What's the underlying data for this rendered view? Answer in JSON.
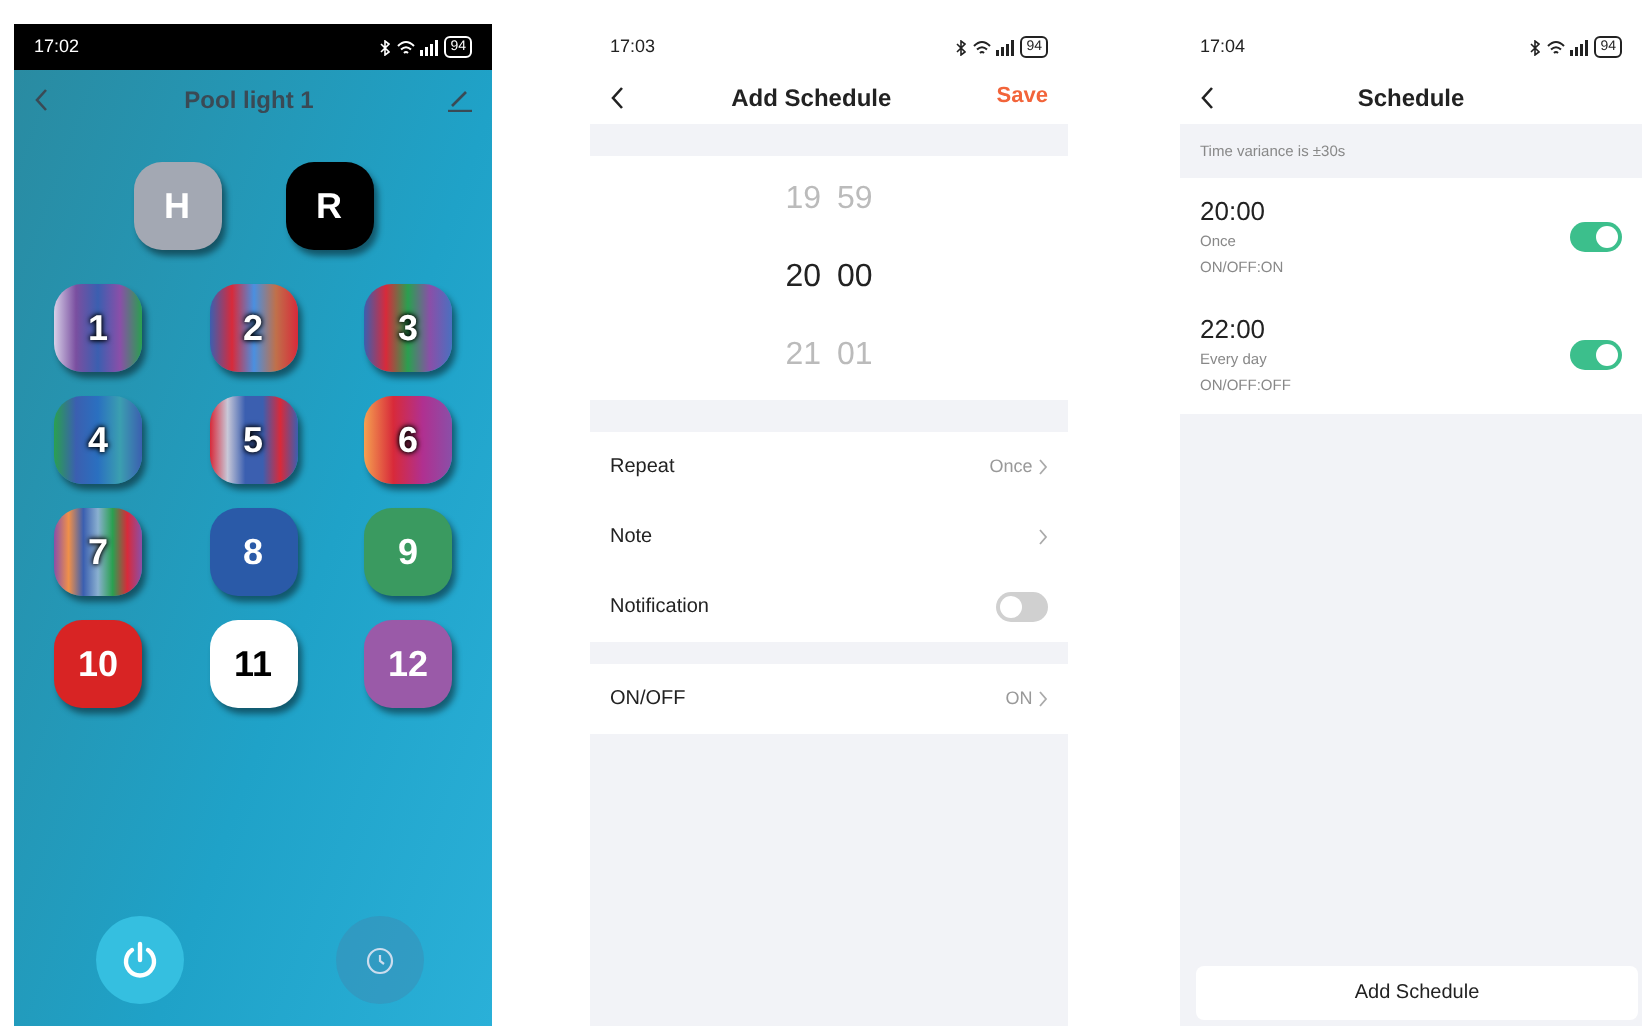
{
  "remote_screen": {
    "status_bar": {
      "time": "17:02",
      "battery": "94"
    },
    "title": "Pool light 1",
    "mode_buttons": [
      {
        "label": "H",
        "color": "#a3a8b3"
      },
      {
        "label": "R",
        "color": "#000000"
      }
    ],
    "color_buttons": [
      {
        "label": "1",
        "kind": "multicolor"
      },
      {
        "label": "2",
        "kind": "multicolor"
      },
      {
        "label": "3",
        "kind": "multicolor"
      },
      {
        "label": "4",
        "kind": "multicolor"
      },
      {
        "label": "5",
        "kind": "multicolor"
      },
      {
        "label": "6",
        "kind": "multicolor"
      },
      {
        "label": "7",
        "kind": "multicolor"
      },
      {
        "label": "8",
        "kind": "solid",
        "color": "#2a5aa8"
      },
      {
        "label": "9",
        "kind": "solid",
        "color": "#3a9a60"
      },
      {
        "label": "10",
        "kind": "solid",
        "color": "#d82424"
      },
      {
        "label": "11",
        "kind": "solid",
        "color": "#ffffff"
      },
      {
        "label": "12",
        "kind": "solid",
        "color": "#9a5aa8"
      }
    ]
  },
  "add_schedule_screen": {
    "status_bar": {
      "time": "17:03",
      "battery": "94"
    },
    "title": "Add Schedule",
    "save": "Save",
    "time_picker": [
      {
        "hour": "19",
        "minute": "59",
        "selected": false
      },
      {
        "hour": "20",
        "minute": "00",
        "selected": true
      },
      {
        "hour": "21",
        "minute": "01",
        "selected": false
      }
    ],
    "settings": [
      {
        "label": "Repeat",
        "kind": "link",
        "value": "Once"
      },
      {
        "label": "Note",
        "kind": "link"
      },
      {
        "label": "Notification",
        "kind": "toggle",
        "on": false
      }
    ],
    "on_off": {
      "label": "ON/OFF",
      "value": "ON"
    }
  },
  "schedule_screen": {
    "status_bar": {
      "time": "17:04",
      "battery": "94"
    },
    "title": "Schedule",
    "notice": "Time variance is ±30s",
    "schedules": [
      {
        "time": "20:00",
        "repeat": "Once",
        "action": "ON/OFF:ON",
        "on": true
      },
      {
        "time": "22:00",
        "repeat": "Every day",
        "action": "ON/OFF:OFF",
        "on": true
      }
    ],
    "add_button": "Add Schedule"
  }
}
